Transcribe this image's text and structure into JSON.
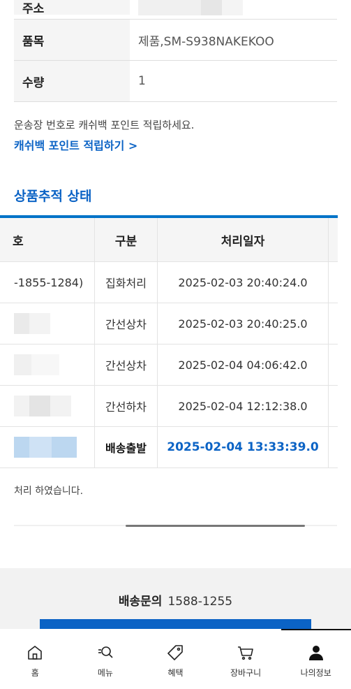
{
  "product_info": {
    "rows": [
      {
        "label": "주소",
        "value": "",
        "partial": true
      },
      {
        "label": "품목",
        "value": "제품,SM-S938NAKEKOO"
      },
      {
        "label": "수량",
        "value": "1"
      }
    ]
  },
  "notice": "운송장 번호로 캐쉬백 포인트 적립하세요.",
  "cashback_link": "캐쉬백 포인트 적립하기 >",
  "tracking": {
    "title": "상품추적 상태",
    "headers": [
      "호",
      "구분",
      "처리일자"
    ],
    "rows": [
      {
        "location": "-1855-1284)",
        "type": "집화처리",
        "datetime": "2025-02-03 20:40:24.0"
      },
      {
        "location": "",
        "type": "간선상차",
        "datetime": "2025-02-03 20:40:25.0"
      },
      {
        "location": "",
        "type": "간선상차",
        "datetime": "2025-02-04 04:06:42.0"
      },
      {
        "location": "",
        "type": "간선하차",
        "datetime": "2025-02-04 12:12:38.0"
      },
      {
        "location": "",
        "type": "배송출발",
        "datetime": "2025-02-04 13:33:39.0"
      }
    ]
  },
  "done_text": "처리 하였습니다.",
  "footer": {
    "inquiry_label": "배송문의",
    "inquiry_phone": "1588-1255"
  },
  "nav": {
    "items": [
      {
        "label": "홈",
        "icon": "home-icon"
      },
      {
        "label": "메뉴",
        "icon": "menu-search-icon"
      },
      {
        "label": "혜택",
        "icon": "tag-icon"
      },
      {
        "label": "장바구니",
        "icon": "cart-icon"
      },
      {
        "label": "나의정보",
        "icon": "user-icon"
      }
    ],
    "active_index": 4
  },
  "colors": {
    "accent": "#0b63c5",
    "table_border": "#0073c8",
    "label_bg": "#f5f5f5"
  }
}
